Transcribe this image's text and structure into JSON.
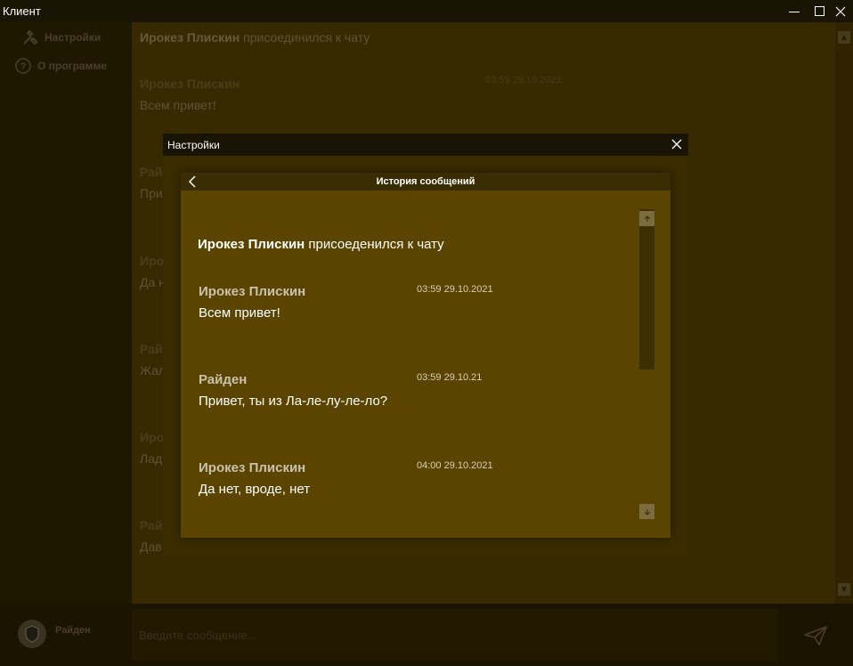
{
  "window": {
    "title": "Клиент"
  },
  "sidebar": {
    "items": [
      {
        "label": "Настройки",
        "icon": "tools-icon"
      },
      {
        "label": "О программе",
        "icon": "help-icon"
      }
    ]
  },
  "chat_background": {
    "system_user": "Ирокез Плискин",
    "system_text": "присоединился к чату",
    "first_message": {
      "name": "Ирокез Плискин",
      "time": "03:59 29.10.2021",
      "text": "Всем привет!"
    },
    "partial_lines": [
      "Рай",
      "При",
      "Ирок",
      "Да н",
      "Рай",
      "Жаль",
      "Ирок",
      "Лад",
      "Рай",
      "Дав"
    ]
  },
  "bottom": {
    "user_name": "Райден",
    "input_placeholder": "Введите сообщение..."
  },
  "modal": {
    "title": "Настройки",
    "card_title": "История сообщений",
    "system_user": "Ирокез Плискин",
    "system_text": "присоеденился к чату",
    "messages": [
      {
        "name": "Ирокез Плискин",
        "time": "03:59 29.10.2021",
        "text": "Всем привет!"
      },
      {
        "name": "Райден",
        "time": "03:59 29.10.21",
        "text": "Привет, ты из Ла-ле-лу-ле-ло?"
      },
      {
        "name": "Ирокез Плискин",
        "time": "04:00 29.10.2021",
        "text": "Да нет, вроде, нет"
      }
    ]
  },
  "colors": {
    "accent": "#5a4400",
    "titlebar": "#1a1404"
  }
}
